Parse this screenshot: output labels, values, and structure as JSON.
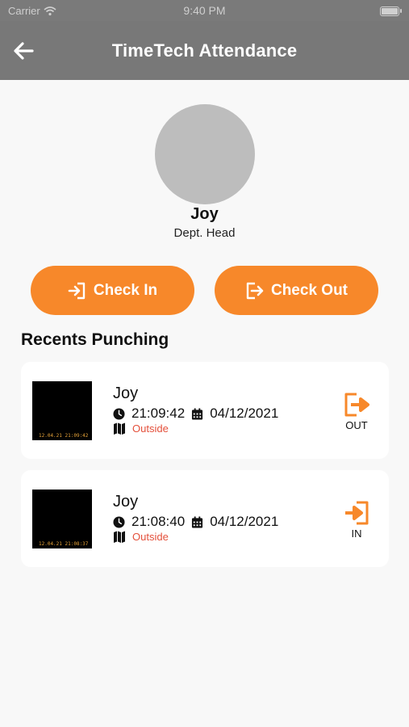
{
  "status_bar": {
    "carrier": "Carrier",
    "time": "9:40 PM"
  },
  "app_bar": {
    "title": "TimeTech Attendance"
  },
  "profile": {
    "name": "Joy",
    "role": "Dept. Head"
  },
  "actions": {
    "check_in": "Check In",
    "check_out": "Check Out"
  },
  "recents": {
    "title": "Recents Punching",
    "items": [
      {
        "name": "Joy",
        "time": "21:09:42",
        "date": "04/12/2021",
        "location": "Outside",
        "type": "OUT",
        "stamp": "12.04.21 21:09:42"
      },
      {
        "name": "Joy",
        "time": "21:08:40",
        "date": "04/12/2021",
        "location": "Outside",
        "type": "IN",
        "stamp": "12.04.21 21:08:37"
      }
    ]
  },
  "colors": {
    "accent": "#F7882A",
    "app_bar": "#787878",
    "location_text": "#E4503B",
    "background": "#F8F8F8"
  }
}
